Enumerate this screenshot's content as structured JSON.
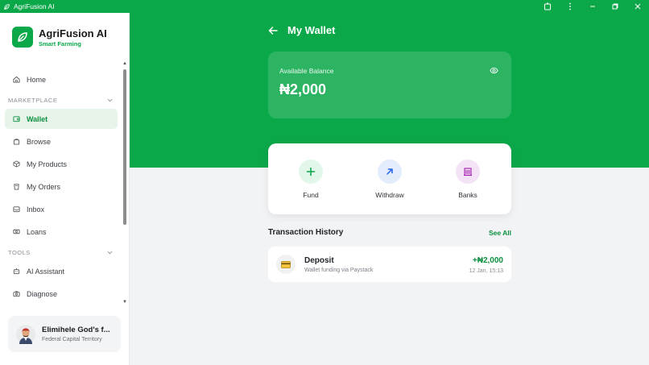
{
  "window": {
    "title": "AgriFusion AI",
    "controls": [
      "extensions-icon",
      "more-icon",
      "minimize-icon",
      "restore-icon",
      "close-icon"
    ]
  },
  "brand": {
    "name": "AgriFusion AI",
    "tagline": "Smart Farming"
  },
  "sidebar": {
    "home": {
      "label": "Home",
      "icon": "home-icon"
    },
    "marketplace_label": "MARKETPLACE",
    "marketplace": [
      {
        "label": "Wallet",
        "icon": "wallet-icon",
        "active": true
      },
      {
        "label": "Browse",
        "icon": "bag-icon"
      },
      {
        "label": "My Products",
        "icon": "box-icon"
      },
      {
        "label": "My Orders",
        "icon": "orders-icon"
      },
      {
        "label": "Inbox",
        "icon": "inbox-icon"
      },
      {
        "label": "Loans",
        "icon": "money-icon"
      }
    ],
    "tools_label": "TOOLS",
    "tools": [
      {
        "label": "AI Assistant",
        "icon": "bot-icon"
      },
      {
        "label": "Diagnose",
        "icon": "camera-icon"
      }
    ]
  },
  "profile": {
    "name": "Elimihele God's f...",
    "location": "Federal Capital Territory"
  },
  "page": {
    "title": "My Wallet"
  },
  "balance": {
    "label": "Available Balance",
    "amount": "₦2,000"
  },
  "actions": [
    {
      "label": "Fund",
      "icon": "plus-icon",
      "color": "#0ba84a",
      "bg": "#e3f6ea"
    },
    {
      "label": "Withdraw",
      "icon": "arrow-up-right-icon",
      "color": "#2563eb",
      "bg": "#e2ecfb"
    },
    {
      "label": "Banks",
      "icon": "bank-icon",
      "color": "#a21caf",
      "bg": "#f4e3f6"
    }
  ],
  "transactions": {
    "title": "Transaction History",
    "see_all": "See All",
    "items": [
      {
        "name": "Deposit",
        "description": "Wallet funding via Paystack",
        "amount": "+₦2,000",
        "date": "12 Jan, 15:13"
      }
    ]
  },
  "colors": {
    "brand": "#0ba84a",
    "active_bg": "#e6f4ea"
  }
}
